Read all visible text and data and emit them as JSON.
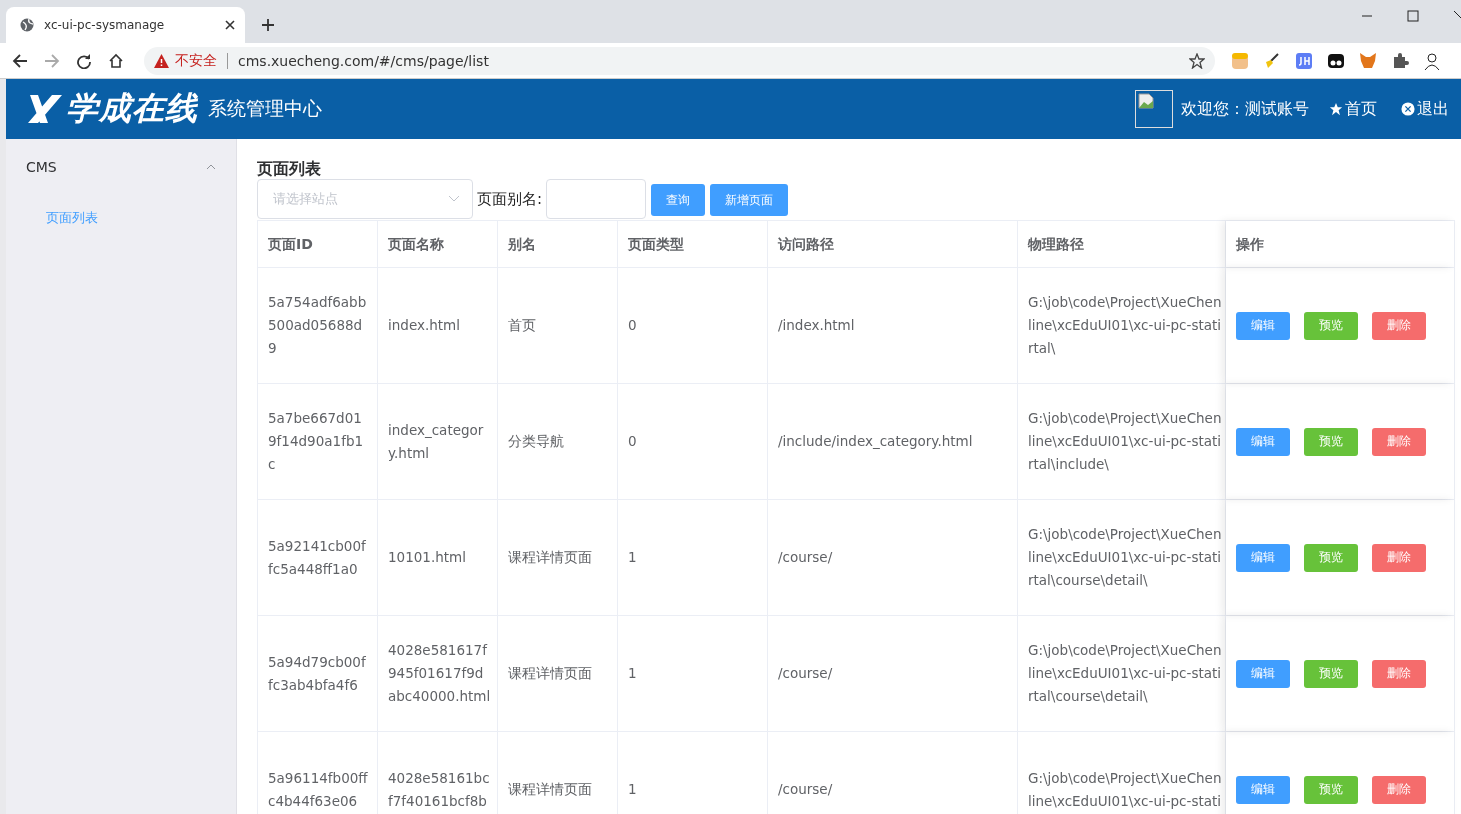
{
  "browser": {
    "tab_title": "xc-ui-pc-sysmanage",
    "security_label": "不安全",
    "url": "cms.xuecheng.com/#/cms/page/list"
  },
  "header": {
    "logo_text": "学成在线",
    "subtitle": "系统管理中心",
    "welcome": "欢迎您：测试账号",
    "home_link": "首页",
    "logout_link": "退出"
  },
  "sidebar": {
    "items": [
      {
        "label": "CMS",
        "expanded": true,
        "children": [
          {
            "label": "页面列表",
            "selected": true
          }
        ]
      }
    ]
  },
  "content": {
    "title": "页面列表",
    "site_select": {
      "placeholder": "请选择站点"
    },
    "alias_label": "页面别名:",
    "buttons": [
      {
        "label": "查询"
      },
      {
        "label": "新增页面"
      }
    ]
  },
  "table": {
    "columns": [
      "页面ID",
      "页面名称",
      "别名",
      "页面类型",
      "访问路径",
      "物理路径",
      "操作"
    ],
    "rows": [
      {
        "id": [
          "5a754adf6abb",
          "500ad05688d",
          "9"
        ],
        "name": [
          "index.html"
        ],
        "alias": "首页",
        "type": "0",
        "url": "/index.html",
        "path": [
          "G:\\job\\code\\Project\\XueChen",
          "line\\xcEduUI01\\xc-ui-pc-stati",
          "rtal\\"
        ],
        "actions": [
          {
            "label": "编辑",
            "kind": "edit"
          },
          {
            "label": "预览",
            "kind": "preview"
          },
          {
            "label": "删除",
            "kind": "delete"
          }
        ]
      },
      {
        "id": [
          "5a7be667d01",
          "9f14d90a1fb1",
          "c"
        ],
        "name": [
          "index_categor",
          "y.html"
        ],
        "alias": "分类导航",
        "type": "0",
        "url": "/include/index_category.html",
        "path": [
          "G:\\job\\code\\Project\\XueChen",
          "line\\xcEduUI01\\xc-ui-pc-stati",
          "rtal\\include\\"
        ],
        "actions": [
          {
            "label": "编辑",
            "kind": "edit"
          },
          {
            "label": "预览",
            "kind": "preview"
          },
          {
            "label": "删除",
            "kind": "delete"
          }
        ]
      },
      {
        "id": [
          "5a92141cb00f",
          "fc5a448ff1a0"
        ],
        "name": [
          "10101.html"
        ],
        "alias": "课程详情页面",
        "type": "1",
        "url": "/course/",
        "path": [
          "G:\\job\\code\\Project\\XueChen",
          "line\\xcEduUI01\\xc-ui-pc-stati",
          "rtal\\course\\detail\\"
        ],
        "actions": [
          {
            "label": "编辑",
            "kind": "edit"
          },
          {
            "label": "预览",
            "kind": "preview"
          },
          {
            "label": "删除",
            "kind": "delete"
          }
        ]
      },
      {
        "id": [
          "5a94d79cb00f",
          "fc3ab4bfa4f6"
        ],
        "name": [
          "4028e581617f",
          "945f01617f9d",
          "abc40000.html"
        ],
        "alias": "课程详情页面",
        "type": "1",
        "url": "/course/",
        "path": [
          "G:\\job\\code\\Project\\XueChen",
          "line\\xcEduUI01\\xc-ui-pc-stati",
          "rtal\\course\\detail\\"
        ],
        "actions": [
          {
            "label": "编辑",
            "kind": "edit"
          },
          {
            "label": "预览",
            "kind": "preview"
          },
          {
            "label": "删除",
            "kind": "delete"
          }
        ]
      },
      {
        "id": [
          "5a96114fb00ff",
          "c4b44f63e06"
        ],
        "name": [
          "4028e58161bc",
          "f7f40161bcf8b"
        ],
        "alias": "课程详情页面",
        "type": "1",
        "url": "/course/",
        "path": [
          "G:\\job\\code\\Project\\XueChen",
          "line\\xcEduUI01\\xc-ui-pc-stati"
        ],
        "actions": [
          {
            "label": "编辑",
            "kind": "edit"
          },
          {
            "label": "预览",
            "kind": "preview"
          },
          {
            "label": "删除",
            "kind": "delete"
          }
        ]
      }
    ]
  }
}
